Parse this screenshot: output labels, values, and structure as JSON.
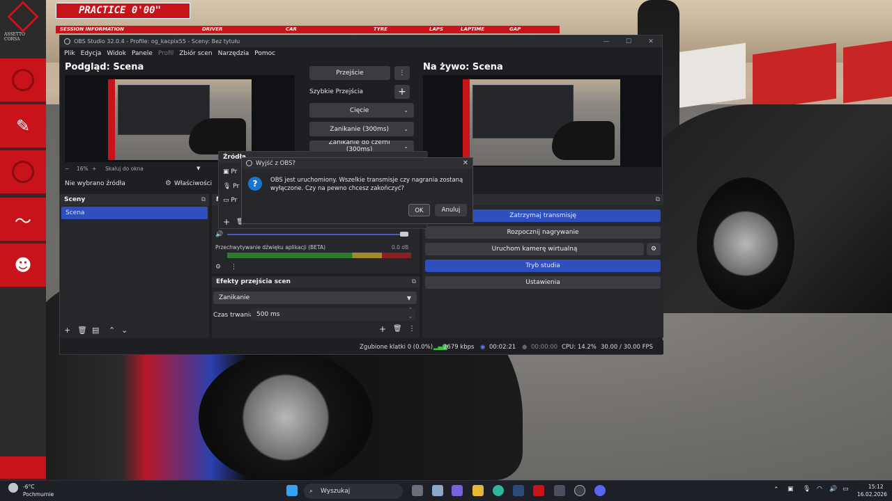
{
  "game": {
    "logo_text": "ASSETTO CORSA",
    "hud_title": "PRACTICE 0'00\"",
    "hud_columns": [
      "SESSION INFORMATION",
      "DRIVER",
      "CAR",
      "TYRE",
      "LAPS",
      "LAPTIME",
      "GAP"
    ],
    "accent_color": "#c8131a"
  },
  "obs": {
    "window_title": "OBS Studio 32.0.4 - Profile: og_kacpix55 - Sceny: Bez tytułu",
    "menu": [
      "Plik",
      "Edycja",
      "Widok",
      "Panele",
      "Profil",
      "Zbiór scen",
      "Narzędzia",
      "Pomoc"
    ],
    "preview_title": "Podgląd: Scena",
    "live_title": "Na żywo: Scena",
    "zoom_label": "16%",
    "scale_label": "Skaluj do okna",
    "no_source": "Nie wybrano źródła",
    "properties": "Właściwości",
    "transition_button": "Przejście",
    "quick_transitions": "Szybkie Przejścia",
    "quick_options": [
      "Cięcie",
      "Zanikanie (300ms)",
      "Zanikanie do czerni (300ms)"
    ],
    "scenes_header": "Sceny",
    "scenes": [
      "Scena"
    ],
    "sources_header": "Źródła",
    "sources_items": [
      "Pr",
      "Pr",
      "Pr"
    ],
    "mixer_track": "Przechwytywanie dźwięku aplikacji (BETA)",
    "mixer_db": "0.0 dB",
    "transitions_header": "Efekty przejścia scen",
    "transition_type": "Zanikanie",
    "duration_label": "Czas trwania",
    "duration_value": "500 ms",
    "controls": {
      "stop_stream": "Zatrzymaj transmisję",
      "start_record": "Rozpocznij nagrywanie",
      "virtual_cam": "Uruchom kamerę wirtualną",
      "studio_mode": "Tryb studia",
      "settings": "Ustawienia"
    },
    "status": {
      "dropped": "Zgubione klatki 0 (0.0%)",
      "bitrate": "2679 kbps",
      "stream_time": "00:02:21",
      "rec_time": "00:00:00",
      "cpu": "CPU: 14.2%",
      "fps": "30.00 / 30.00 FPS"
    }
  },
  "modal": {
    "title": "Wyjść z OBS?",
    "message": "OBS jest uruchomiony. Wszelkie transmisje czy nagrania zostaną wyłączone. Czy na pewno chcesz zakończyć?",
    "ok": "OK",
    "cancel": "Anuluj"
  },
  "taskbar": {
    "weather_temp": "-6°C",
    "weather_desc": "Pochmurnie",
    "search": "Wyszukaj",
    "time": "15:12",
    "date": "16.02.2026"
  }
}
